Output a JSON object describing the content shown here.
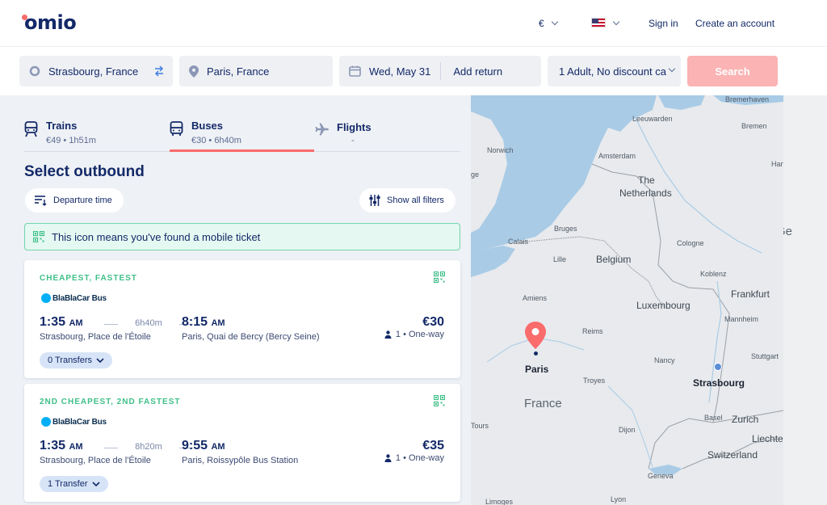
{
  "header": {
    "logo": "omio",
    "currency": "€",
    "sign_in": "Sign in",
    "create_account": "Create an account"
  },
  "search": {
    "origin": "Strasbourg, France",
    "destination": "Paris, France",
    "date": "Wed, May 31",
    "add_return": "Add return",
    "passengers": "1 Adult, No discount ca",
    "button": "Search"
  },
  "tabs": [
    {
      "name": "Trains",
      "sub": "€49 • 1h51m"
    },
    {
      "name": "Buses",
      "sub": "€30 • 6h40m"
    },
    {
      "name": "Flights",
      "sub": "-"
    }
  ],
  "results": {
    "title": "Select outbound",
    "departure_filter": "Departure time",
    "filters_button": "Show all filters",
    "notice": "This icon means you've found a mobile ticket",
    "cards": [
      {
        "badge": "CHEAPEST,  FASTEST",
        "operator": "BlaBlaCar Bus",
        "dep_time": "1:35",
        "dep_ampm": "AM",
        "duration": "6h40m",
        "arr_time": "8:15",
        "arr_ampm": "AM",
        "dep_station": "Strasbourg, Place de l'Étoile",
        "arr_station": "Paris, Quai de Bercy (Bercy Seine)",
        "price": "€30",
        "pax": "1 • One-way",
        "transfers": "0 Transfers"
      },
      {
        "badge": "2ND CHEAPEST,  2ND FASTEST",
        "operator": "BlaBlaCar Bus",
        "dep_time": "1:35",
        "dep_ampm": "AM",
        "duration": "8h20m",
        "arr_time": "9:55",
        "arr_ampm": "AM",
        "dep_station": "Strasbourg, Place de l'Étoile",
        "arr_station": "Paris, Roissypôle Bus Station",
        "price": "€35",
        "pax": "1 • One-way",
        "transfers": "1 Transfer"
      }
    ]
  },
  "map": {
    "labels": {
      "bremerhaven": "Bremerhaven",
      "leeuwarden": "Leeuwarden",
      "bremen": "Bremen",
      "norwich": "Norwich",
      "amsterdam": "Amsterdam",
      "the": "The",
      "netherlands": "Netherlands",
      "ge": "ge",
      "han": "Han",
      "calais": "Calais",
      "bruges": "Bruges",
      "cologne": "Cologne",
      "lille": "Lille",
      "belgium": "Belgium",
      "koblenz": "Koblenz",
      "amiens": "Amiens",
      "luxembourg": "Luxembourg",
      "frankfurt": "Frankfurt",
      "reims": "Reims",
      "mannheim": "Mannheim",
      "paris": "Paris",
      "nancy": "Nancy",
      "stuttgart": "Stuttgart",
      "strasbourg": "Strasbourg",
      "troyes": "Troyes",
      "france": "France",
      "tours": "Tours",
      "basel": "Basel",
      "zurich": "Zurich",
      "dijon": "Dijon",
      "liechten": "Liechten",
      "switzerland": "Switzerland",
      "geneva": "Geneva",
      "lyon": "Lyon",
      "limoges": "Limoges",
      "h": "H",
      "ge2": "Ge"
    },
    "colors": {
      "sea": "#a9cbe6",
      "land": "#e8eaed",
      "pin": "#fa6b6b",
      "origin_dot": "#5b8fd6"
    }
  }
}
